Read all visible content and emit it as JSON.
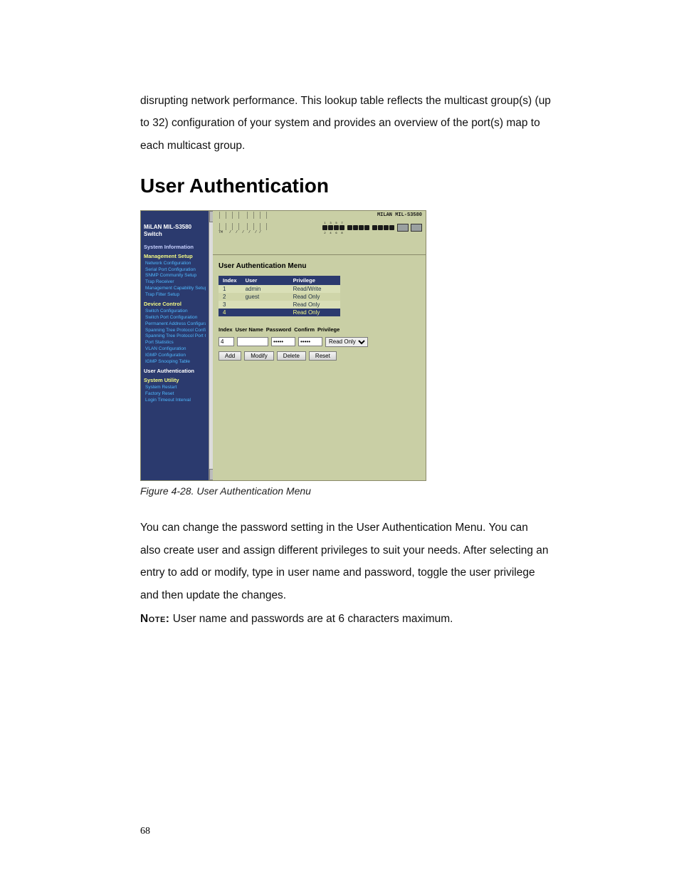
{
  "page_number": "68",
  "intro_paragraph": "disrupting network performance.  This lookup table reflects the multicast group(s) (up to 32) configuration of your system and provides an overview of the port(s) map to each multicast group.",
  "section_heading": "User Authentication",
  "figure_caption": "Figure 4-28. User Authentication Menu",
  "body_paragraph": "You can change the password setting in the User Authentication Menu.  You can also create user and assign different privileges to suit your needs.  After selecting an entry to add or modify, type in user name and password, toggle the user privilege and then update the changes.",
  "note_label": "Note:",
  "note_text": "  User name and passwords are at 6 characters maximum.",
  "screenshot": {
    "product_brand": "MiLAN MIL-S3580 Switch",
    "model_label": "MILAN MIL-S3580",
    "ascii_logo_lines": [
      " |  |  |  |   |  |  |  |",
      " |  |  |  |   |  |  |  |",
      "                         ",
      " |  |  |  |   |  |  |  |",
      " |  |  |  |   |  |  |  |",
      " TM   /  /  /  /  / / "
    ],
    "sidebar": {
      "system_information": "System Information",
      "management_setup": "Management Setup",
      "mgmt_items": [
        "Network Configuration",
        "Serial Port Configuration",
        "SNMP Community Setup",
        "Trap Receiver",
        "Management Capability Setup",
        "Trap Filter Setup"
      ],
      "device_control": "Device Control",
      "dev_items": [
        "Switch Configuration",
        "Switch Port Configuration",
        "Permanent Address Configuration",
        "Spanning Tree Protocol Configuration",
        "Spanning Tree Protocol Port Configuration",
        "Port Statistics",
        "VLAN Configuration",
        "IGMP Configuration",
        "IGMP Snooping Table"
      ],
      "user_auth": "User Authentication",
      "system_utility": "System Utility",
      "util_items": [
        "System Restart",
        "Factory Reset",
        "Login Timeout Interval"
      ]
    },
    "main": {
      "menu_title": "User Authentication Menu",
      "table": {
        "headers": {
          "index": "Index",
          "user": "User",
          "privilege": "Privilege"
        },
        "rows": [
          {
            "index": "1",
            "user": "admin",
            "privilege": "Read/Write"
          },
          {
            "index": "2",
            "user": "guest",
            "privilege": "Read Only"
          },
          {
            "index": "3",
            "user": "",
            "privilege": "Read Only"
          },
          {
            "index": "4",
            "user": "",
            "privilege": "Read Only"
          }
        ]
      },
      "form": {
        "labels": {
          "index": "Index",
          "user": "User Name",
          "password": "Password",
          "confirm": "Confirm",
          "privilege": "Privilege"
        },
        "index_value": "4",
        "username_value": "",
        "password_value": "*****",
        "confirm_value": "*****",
        "privilege_value": "Read Only"
      },
      "buttons": {
        "add": "Add",
        "modify": "Modify",
        "delete": "Delete",
        "reset": "Reset"
      }
    }
  }
}
